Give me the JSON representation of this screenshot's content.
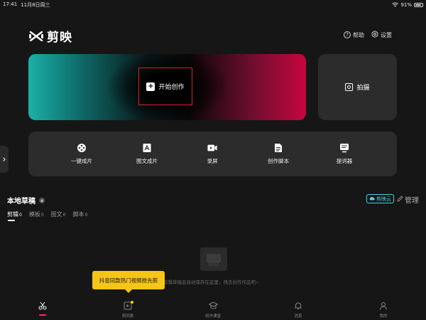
{
  "status_bar": {
    "time": "17:41",
    "date": "11月8日周三",
    "battery_percent": "91%",
    "battery_level": 0.91
  },
  "app": {
    "name": "剪映"
  },
  "header": {
    "help_label": "帮助",
    "settings_label": "设置"
  },
  "hero": {
    "create_label": "开始创作"
  },
  "shoot": {
    "label": "拍摄"
  },
  "tools": [
    {
      "label": "一键成片",
      "icon": "film-reel-icon"
    },
    {
      "label": "图文成片",
      "icon": "text-to-video-icon"
    },
    {
      "label": "录屏",
      "icon": "screen-record-icon"
    },
    {
      "label": "创作脚本",
      "icon": "script-doc-icon"
    },
    {
      "label": "提词器",
      "icon": "teleprompter-icon"
    }
  ],
  "drafts": {
    "title": "本地草稿",
    "cloud_label": "剪映云",
    "manage_label": "管理",
    "tabs": [
      {
        "label": "剪辑",
        "count": "0"
      },
      {
        "label": "模板",
        "count": "0"
      },
      {
        "label": "图文",
        "count": "0"
      },
      {
        "label": "脚本",
        "count": "0"
      }
    ],
    "empty_text": "剪辑草稿会自动保存在这里，快去创作作品吧~"
  },
  "tooltip": {
    "text": "抖音同款热门视频抢先剪"
  },
  "bottom_nav": [
    {
      "label": "",
      "icon": "scissors-icon"
    },
    {
      "label": "剪同款",
      "icon": "template-icon"
    },
    {
      "label": "创作课堂",
      "icon": "graduation-cap-icon"
    },
    {
      "label": "消息",
      "icon": "bell-icon"
    },
    {
      "label": "我的",
      "icon": "person-icon"
    }
  ],
  "colors": {
    "accent_red": "#ff2d55",
    "cloud_blue": "#4fd1e0",
    "tooltip_yellow": "#f5c518",
    "highlight_box": "#d9232c"
  }
}
